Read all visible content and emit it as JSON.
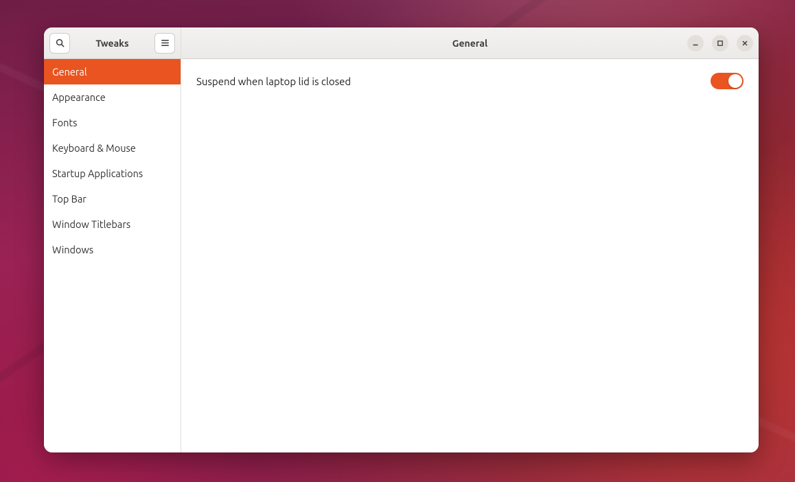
{
  "app": {
    "title": "Tweaks"
  },
  "header": {
    "page_title": "General"
  },
  "sidebar": {
    "items": [
      {
        "label": "General",
        "active": true
      },
      {
        "label": "Appearance",
        "active": false
      },
      {
        "label": "Fonts",
        "active": false
      },
      {
        "label": "Keyboard & Mouse",
        "active": false
      },
      {
        "label": "Startup Applications",
        "active": false
      },
      {
        "label": "Top Bar",
        "active": false
      },
      {
        "label": "Window Titlebars",
        "active": false
      },
      {
        "label": "Windows",
        "active": false
      }
    ]
  },
  "settings": {
    "suspend_lid": {
      "label": "Suspend when laptop lid is closed",
      "value": true
    }
  },
  "colors": {
    "accent": "#e95420"
  }
}
